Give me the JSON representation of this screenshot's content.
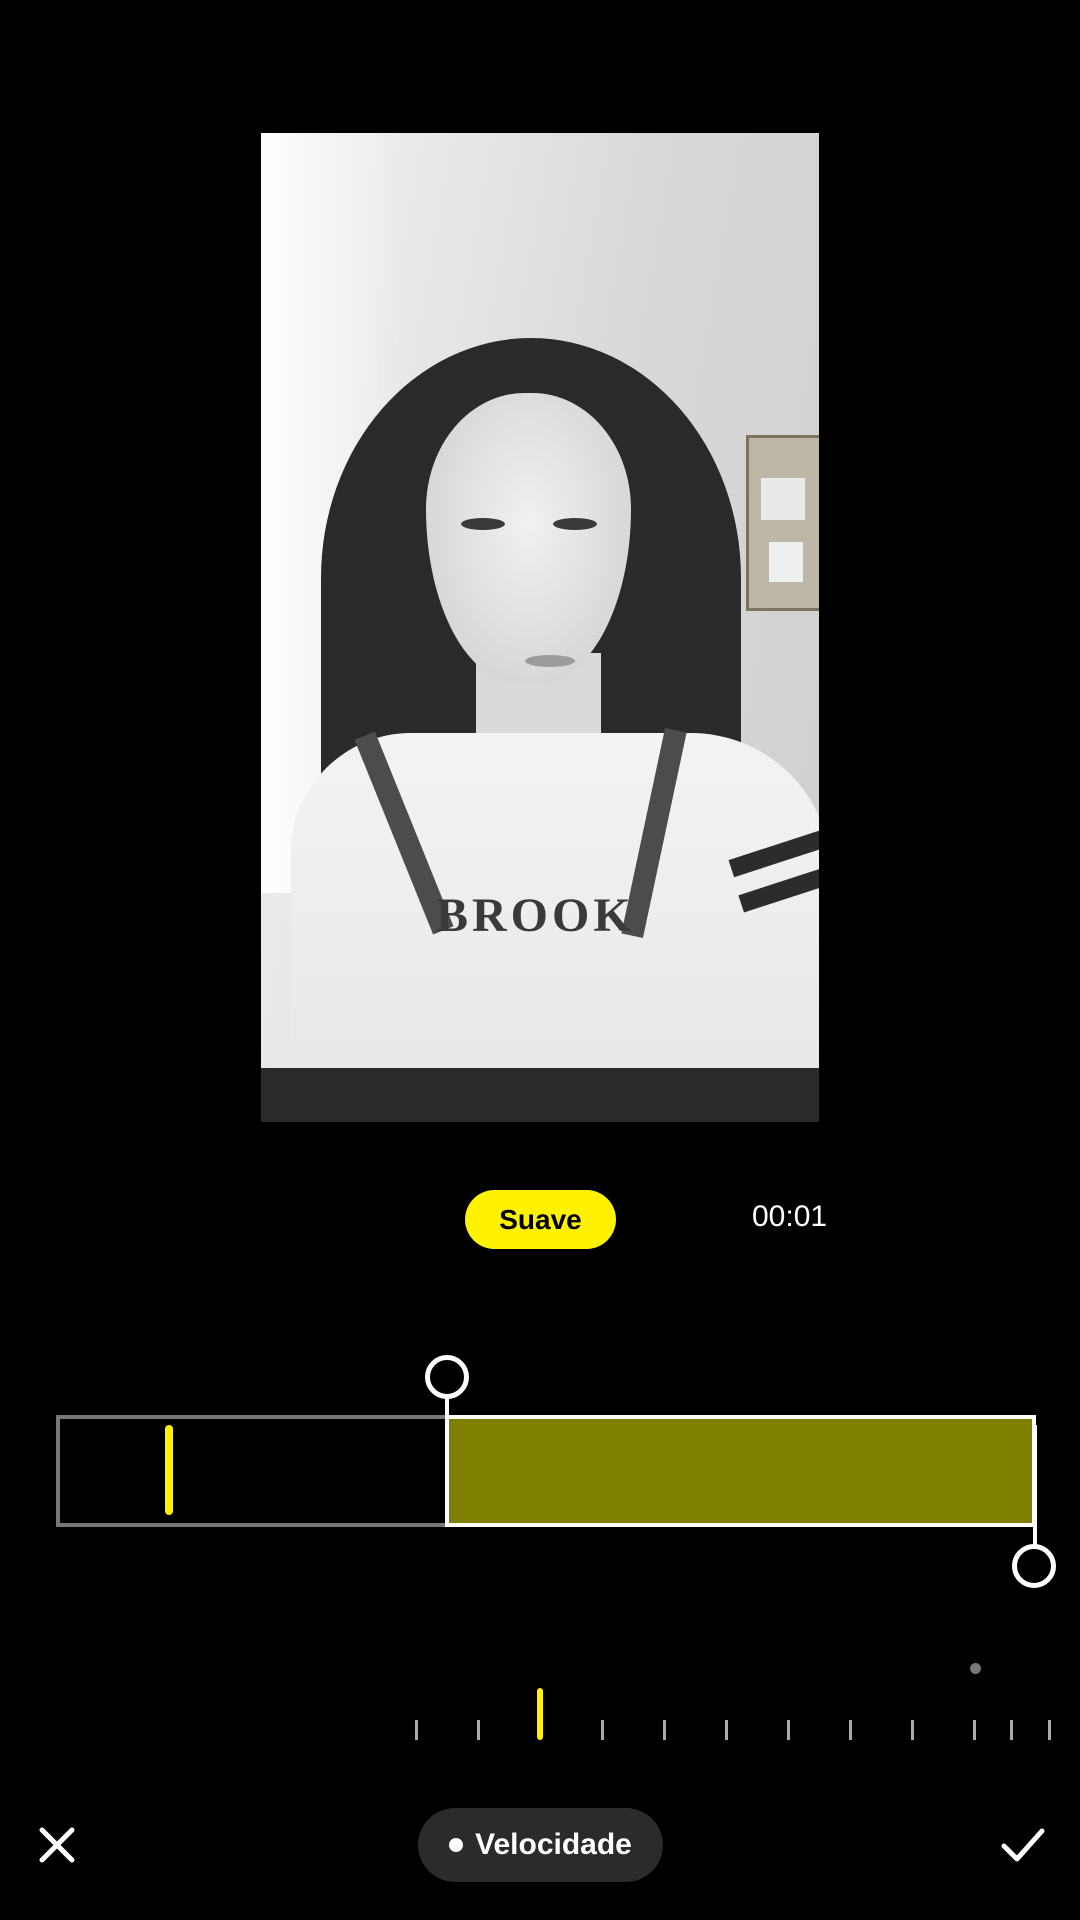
{
  "preview": {
    "print_text": "BROOK"
  },
  "controls": {
    "mode_label": "Suave",
    "time": "00:01"
  },
  "timeline": {
    "playhead_fraction": 0.1,
    "selection_start_fraction": 0.4,
    "selection_end_fraction": 1.0
  },
  "bottom_bar": {
    "speed_label": "Velocidade"
  },
  "colors": {
    "accent": "#fff200",
    "selection_fill": "#7f7f00",
    "pill_bg": "#2b2b2b"
  },
  "icons": {
    "close": "close-icon",
    "confirm": "check-icon",
    "speed_dot": "dot-icon"
  }
}
